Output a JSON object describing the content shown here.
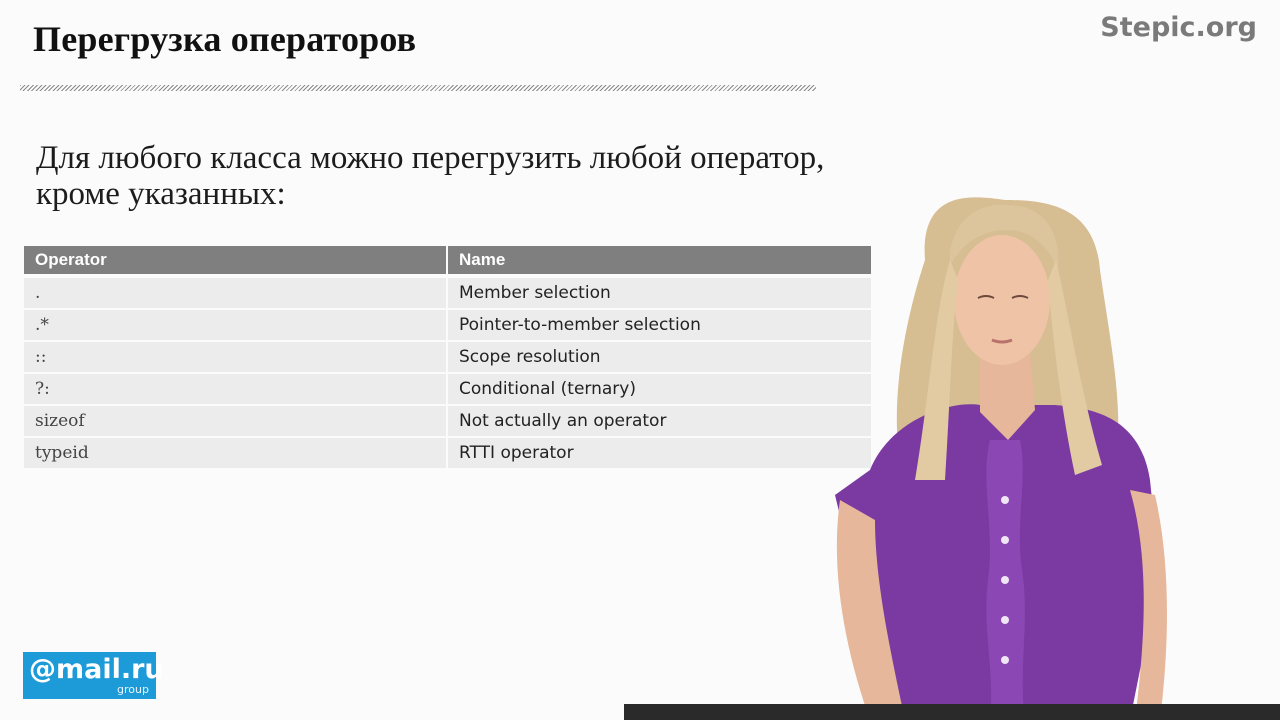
{
  "slide": {
    "title": "Перегрузка операторов",
    "brand": "Stepic.org",
    "intro_line1": "Для любого класса можно перегрузить любой оператор,",
    "intro_line2": "кроме указанных:"
  },
  "table": {
    "headers": [
      "Operator",
      "Name"
    ],
    "rows": [
      {
        "operator": ".",
        "name": "Member selection"
      },
      {
        "operator": ".*",
        "name": "Pointer-to-member selection"
      },
      {
        "operator": "::",
        "name": "Scope resolution"
      },
      {
        "operator": "?:",
        "name": "Conditional (ternary)"
      },
      {
        "operator": "sizeof",
        "name": "Not actually an operator"
      },
      {
        "operator": "typeid",
        "name": "RTTI operator"
      }
    ]
  },
  "logo": {
    "main": "@mail.ru",
    "sub": "group"
  },
  "colors": {
    "header_bg": "#7f7f7f",
    "row_bg": "#ececec",
    "logo_bg": "#1d9bd9",
    "blouse": "#7b3aa2"
  }
}
